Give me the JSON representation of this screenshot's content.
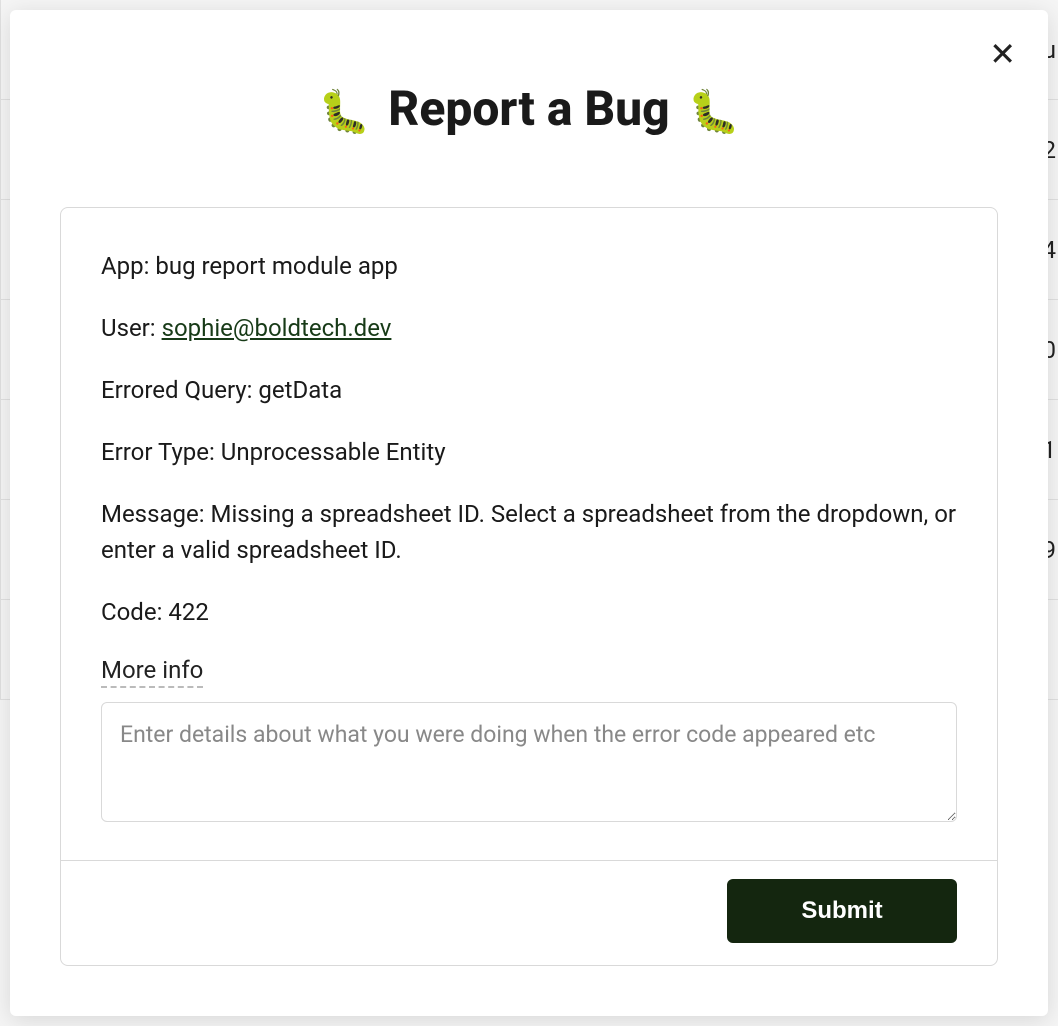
{
  "background": {
    "rows": [
      "u",
      "2",
      "4",
      "0",
      "1",
      "9",
      ""
    ]
  },
  "modal": {
    "close_label": "✕",
    "title_emoji": "🐛",
    "title": "Report a Bug",
    "fields": {
      "app_label": "App: ",
      "app_value": "bug report module app",
      "user_label": "User: ",
      "user_value": "sophie@boldtech.dev",
      "query_label": "Errored Query: ",
      "query_value": "getData",
      "error_type_label": "Error Type: ",
      "error_type_value": "Unprocessable Entity",
      "message_label": "Message: ",
      "message_value": "Missing a spreadsheet ID. Select a spreadsheet from the dropdown, or enter a valid spreadsheet ID.",
      "code_label": "Code: ",
      "code_value": "422"
    },
    "more_info_label": "More info",
    "details_placeholder": "Enter details about what you were doing when the error code appeared etc",
    "submit_label": "Submit"
  }
}
